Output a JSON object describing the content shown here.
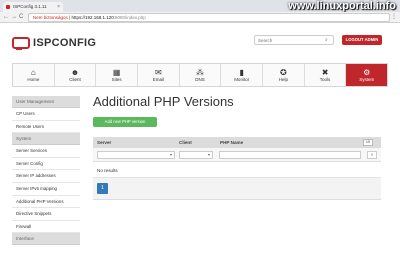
{
  "browser": {
    "tab_title": "ISPConfig 3.1.11",
    "tab_close": "×",
    "back": "←",
    "forward": "→",
    "reload": "C",
    "security": "Nem biztonságos",
    "url_host": "https://192.168.1.120",
    "url_path": ":8080/index.php",
    "menu": "⋮"
  },
  "watermark": "www.linuxportal.info",
  "header": {
    "logo_text": "ISPCONFIG",
    "search_placeholder": "Search",
    "search_icon": "⌕",
    "logout_label": "LOGOUT ADMIN"
  },
  "modules": [
    {
      "label": "Home",
      "icon": "⌂"
    },
    {
      "label": "Client",
      "icon": "☻"
    },
    {
      "label": "Sites",
      "icon": "▦"
    },
    {
      "label": "Email",
      "icon": "✉"
    },
    {
      "label": "DNS",
      "icon": "⁂"
    },
    {
      "label": "Monitor",
      "icon": "▮"
    },
    {
      "label": "Help",
      "icon": "✪"
    },
    {
      "label": "Tools",
      "icon": "✖"
    },
    {
      "label": "System",
      "icon": "⚙"
    }
  ],
  "active_module": "System",
  "sidebar": {
    "groups": [
      {
        "heading": "User Management",
        "items": [
          "CP Users",
          "Remote Users"
        ]
      },
      {
        "heading": "System",
        "items": [
          "Server Services",
          "Server Config",
          "Server IP addresses",
          "Server IPv6 mapping",
          "Additional PHP Versions",
          "Directive Snippets",
          "Firewall"
        ]
      },
      {
        "heading": "Interface",
        "items": []
      }
    ]
  },
  "main": {
    "title": "Additional PHP Versions",
    "add_button": "Add new PHP version",
    "columns": [
      "Server",
      "Client",
      "PHP Name"
    ],
    "per_page": "15",
    "filter_search_icon": "⌕",
    "no_results": "No results",
    "pagination": [
      "1"
    ]
  },
  "colors": {
    "accent": "#c0272d",
    "add_button": "#5cb85c",
    "page_active": "#337ab7"
  }
}
